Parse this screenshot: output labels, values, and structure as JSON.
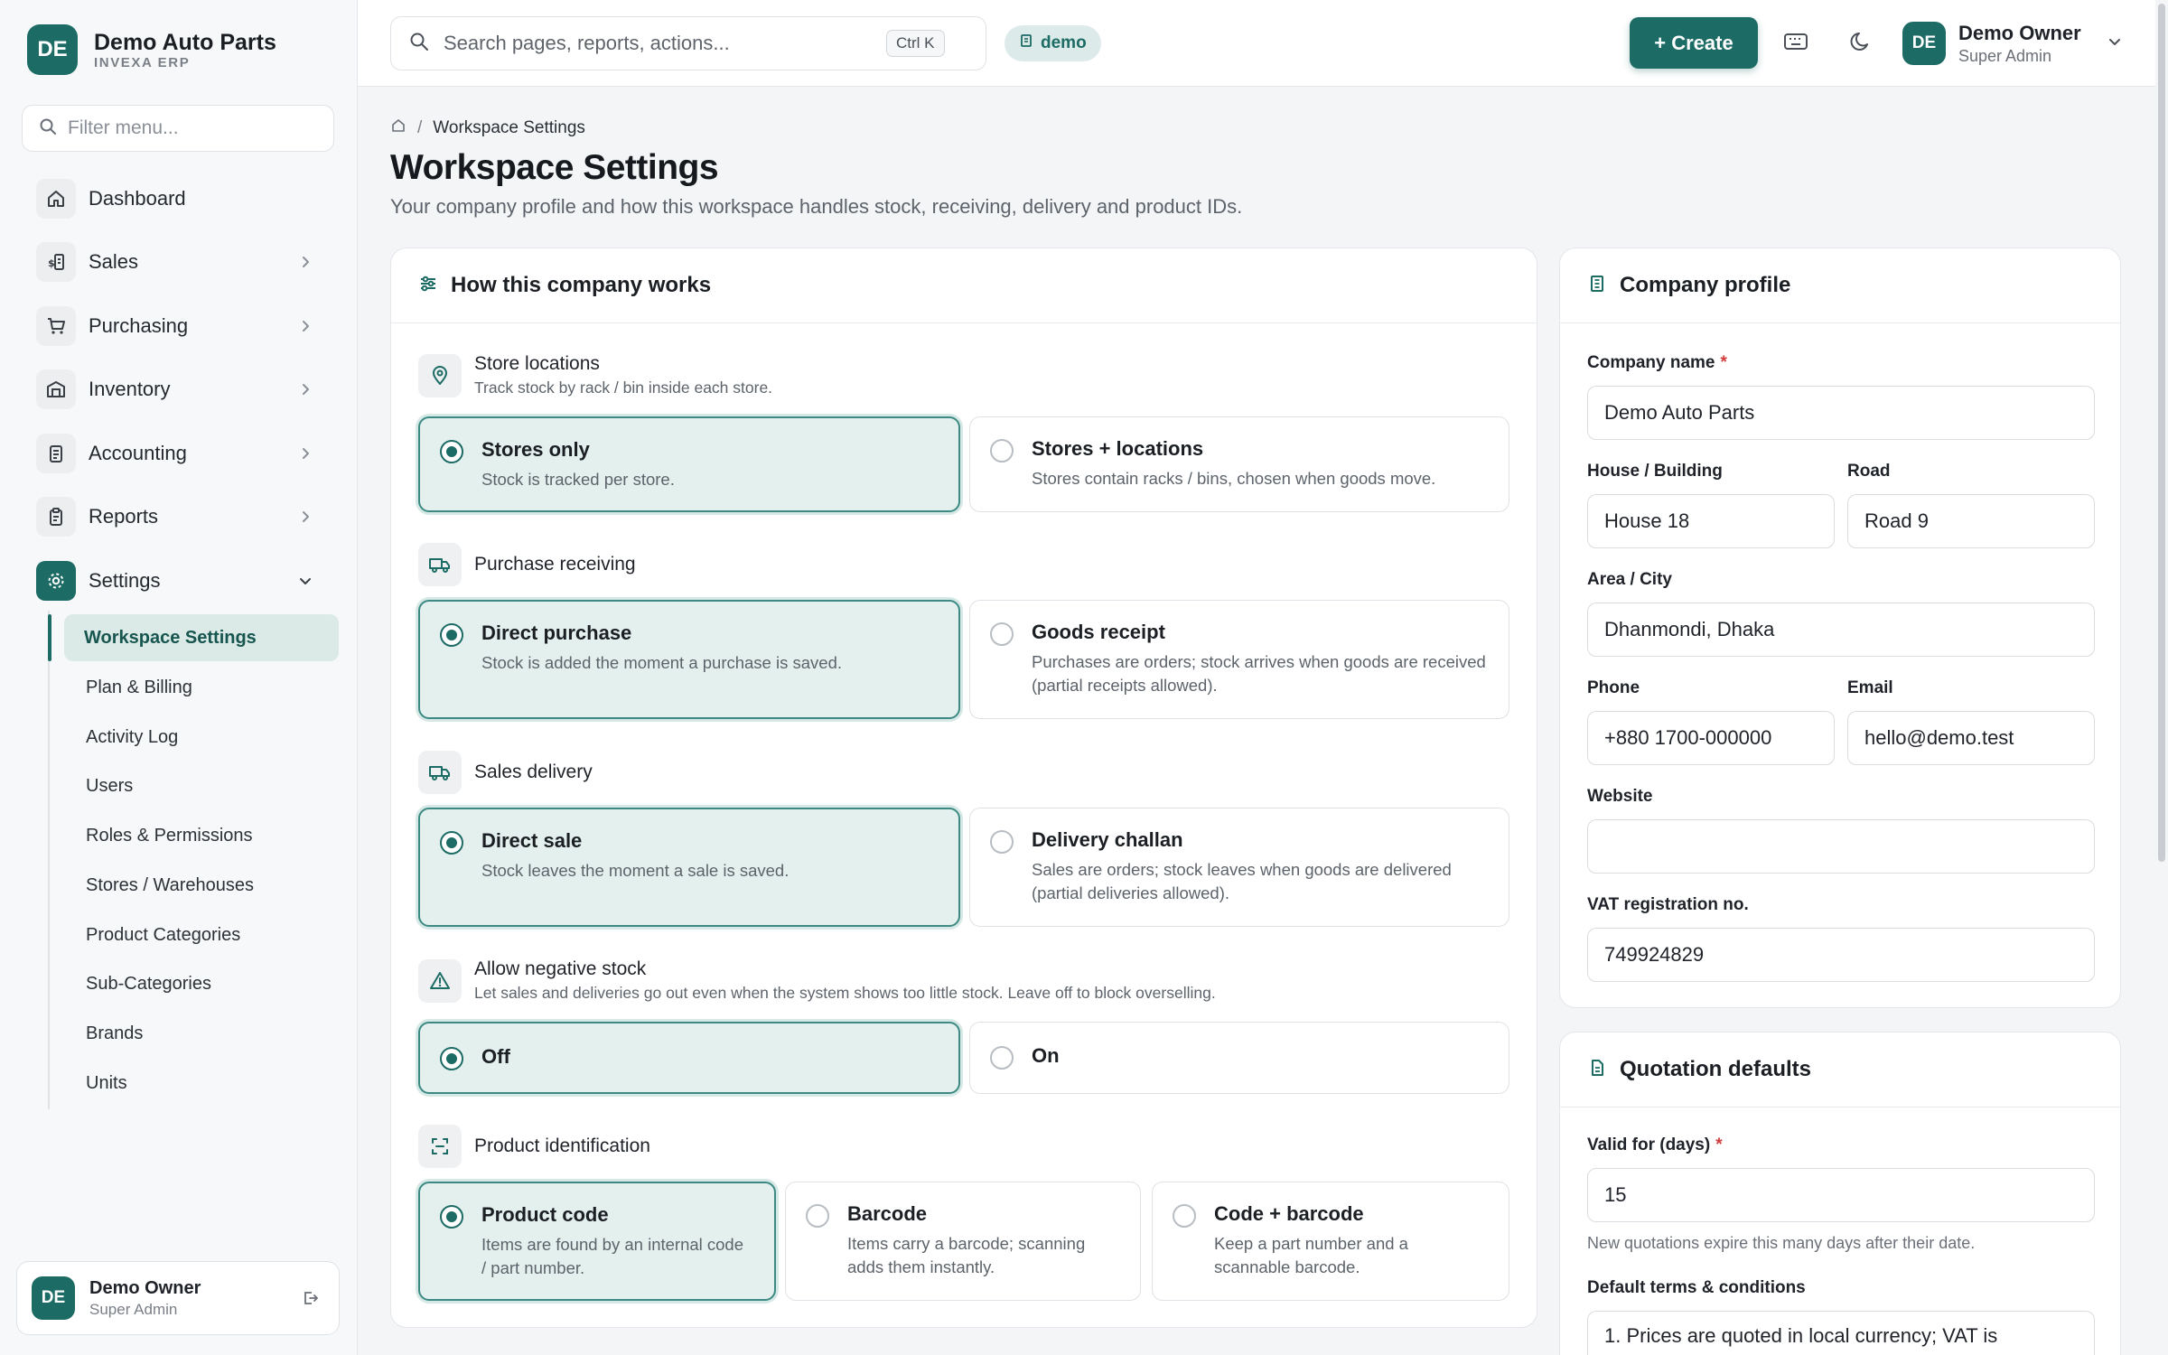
{
  "brand": {
    "initials": "DE",
    "name": "Demo Auto Parts",
    "sub": "INVEXA ERP"
  },
  "sidebar": {
    "filter_placeholder": "Filter menu...",
    "items": [
      {
        "label": "Dashboard"
      },
      {
        "label": "Sales"
      },
      {
        "label": "Purchasing"
      },
      {
        "label": "Inventory"
      },
      {
        "label": "Accounting"
      },
      {
        "label": "Reports"
      },
      {
        "label": "Settings"
      }
    ],
    "settings_sub": [
      {
        "label": "Workspace Settings"
      },
      {
        "label": "Plan & Billing"
      },
      {
        "label": "Activity Log"
      },
      {
        "label": "Users"
      },
      {
        "label": "Roles & Permissions"
      },
      {
        "label": "Stores / Warehouses"
      },
      {
        "label": "Product Categories"
      },
      {
        "label": "Sub-Categories"
      },
      {
        "label": "Brands"
      },
      {
        "label": "Units"
      }
    ],
    "user": {
      "initials": "DE",
      "name": "Demo Owner",
      "role": "Super Admin"
    }
  },
  "topbar": {
    "search_placeholder": "Search pages, reports, actions...",
    "shortcut": "Ctrl K",
    "tenant": "demo",
    "create_label": "+ Create",
    "user": {
      "initials": "DE",
      "name": "Demo Owner",
      "role": "Super Admin"
    }
  },
  "breadcrumb": {
    "separator": "/",
    "current": "Workspace Settings"
  },
  "page": {
    "title": "Workspace Settings",
    "subtitle": "Your company profile and how this workspace handles stock, receiving, delivery and product IDs."
  },
  "how_card": {
    "title": "How this company works",
    "sections": {
      "store_locations": {
        "title": "Store locations",
        "desc": "Track stock by rack / bin inside each store.",
        "options": [
          {
            "title": "Stores only",
            "desc": "Stock is tracked per store.",
            "selected": true
          },
          {
            "title": "Stores + locations",
            "desc": "Stores contain racks / bins, chosen when goods move.",
            "selected": false
          }
        ]
      },
      "purchase_receiving": {
        "title": "Purchase receiving",
        "options": [
          {
            "title": "Direct purchase",
            "desc": "Stock is added the moment a purchase is saved.",
            "selected": true
          },
          {
            "title": "Goods receipt",
            "desc": "Purchases are orders; stock arrives when goods are received (partial receipts allowed).",
            "selected": false
          }
        ]
      },
      "sales_delivery": {
        "title": "Sales delivery",
        "options": [
          {
            "title": "Direct sale",
            "desc": "Stock leaves the moment a sale is saved.",
            "selected": true
          },
          {
            "title": "Delivery challan",
            "desc": "Sales are orders; stock leaves when goods are delivered (partial deliveries allowed).",
            "selected": false
          }
        ]
      },
      "negative_stock": {
        "title": "Allow negative stock",
        "desc": "Let sales and deliveries go out even when the system shows too little stock. Leave off to block overselling.",
        "options": [
          {
            "title": "Off",
            "selected": true
          },
          {
            "title": "On",
            "selected": false
          }
        ]
      },
      "product_identification": {
        "title": "Product identification",
        "options": [
          {
            "title": "Product code",
            "desc": "Items are found by an internal code / part number.",
            "selected": true
          },
          {
            "title": "Barcode",
            "desc": "Items carry a barcode; scanning adds them instantly.",
            "selected": false
          },
          {
            "title": "Code + barcode",
            "desc": "Keep a part number and a scannable barcode.",
            "selected": false
          }
        ]
      }
    }
  },
  "company_profile": {
    "title": "Company profile",
    "required_mark": "*",
    "fields": {
      "company_name": {
        "label": "Company name",
        "value": "Demo Auto Parts"
      },
      "house": {
        "label": "House / Building",
        "value": "House 18"
      },
      "road": {
        "label": "Road",
        "value": "Road 9"
      },
      "area": {
        "label": "Area / City",
        "value": "Dhanmondi, Dhaka"
      },
      "phone": {
        "label": "Phone",
        "value": "+880 1700-000000"
      },
      "email": {
        "label": "Email",
        "value": "hello@demo.test"
      },
      "website": {
        "label": "Website",
        "value": ""
      },
      "vat": {
        "label": "VAT registration no.",
        "value": "749924829"
      }
    }
  },
  "quotation_defaults": {
    "title": "Quotation defaults",
    "valid_label": "Valid for (days)",
    "valid_value": "15",
    "valid_help": "New quotations expire this many days after their date.",
    "terms_label": "Default terms & conditions",
    "terms_value": "1. Prices are quoted in local currency; VAT is"
  },
  "colors": {
    "accent": "#1c6b64",
    "accent_light": "#e3f0ee",
    "required": "#d23b3b"
  }
}
